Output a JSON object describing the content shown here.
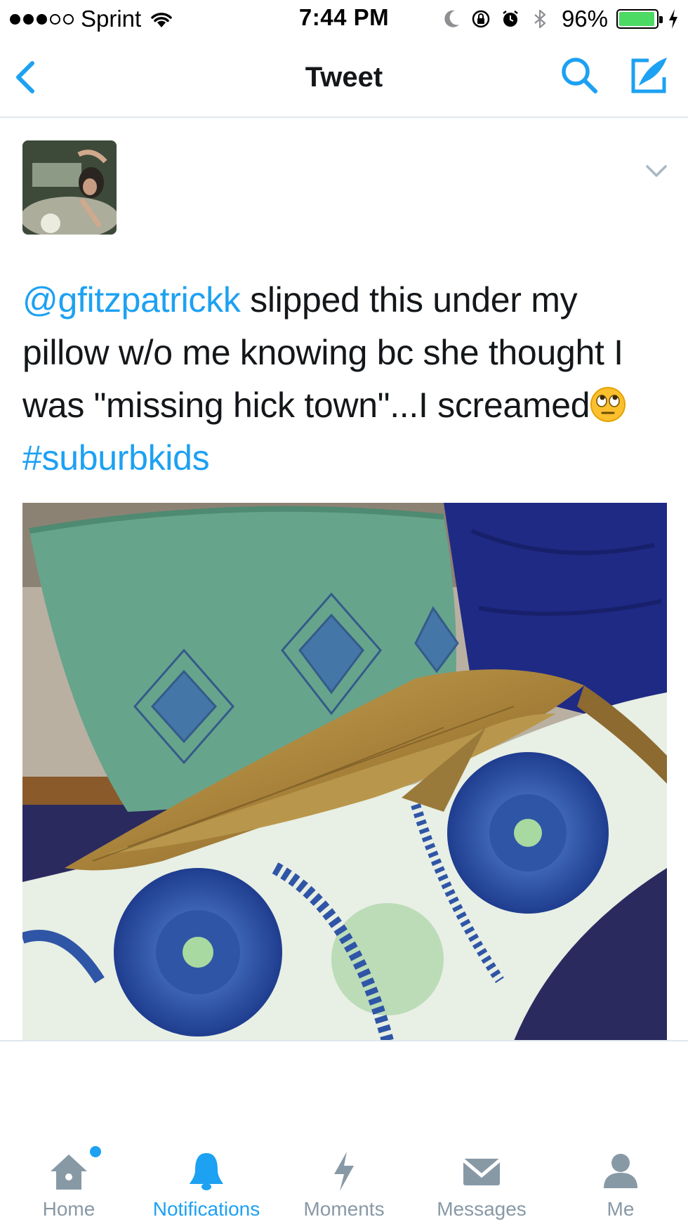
{
  "status_bar": {
    "carrier": "Sprint",
    "time": "7:44 PM",
    "battery_percent": "96%",
    "battery_level": 0.96,
    "icons": [
      "signal-dots-icon",
      "wifi-icon",
      "moon-icon",
      "rotation-lock-icon",
      "alarm-icon",
      "bluetooth-icon",
      "battery-icon",
      "charging-bolt-icon"
    ]
  },
  "nav": {
    "title": "Tweet",
    "icons": [
      "back-chevron-icon",
      "search-icon",
      "compose-icon"
    ]
  },
  "tweet": {
    "mention": "@gfitzpatrickk",
    "text": " slipped this under my pillow w/o me knowing bc she thought I was \"missing hick town\"...I screamed",
    "emoji": "face-with-rolling-eyes-emoji",
    "hashtag": "#suburbkids",
    "icons": [
      "avatar-photo",
      "caret-down-icon"
    ]
  },
  "tabbar": {
    "tabs": [
      {
        "label": "Home",
        "icon": "home-icon",
        "active": false,
        "badge": true
      },
      {
        "label": "Notifications",
        "icon": "bell-icon",
        "active": true,
        "badge": false
      },
      {
        "label": "Moments",
        "icon": "lightning-icon",
        "active": false,
        "badge": false
      },
      {
        "label": "Messages",
        "icon": "envelope-icon",
        "active": false,
        "badge": false
      },
      {
        "label": "Me",
        "icon": "person-icon",
        "active": false,
        "badge": false
      }
    ]
  },
  "colors": {
    "accent": "#1da1f2",
    "inactive": "#8899a6",
    "text": "#14171a",
    "divider": "#e1e8ed",
    "battery": "#4cd964"
  }
}
